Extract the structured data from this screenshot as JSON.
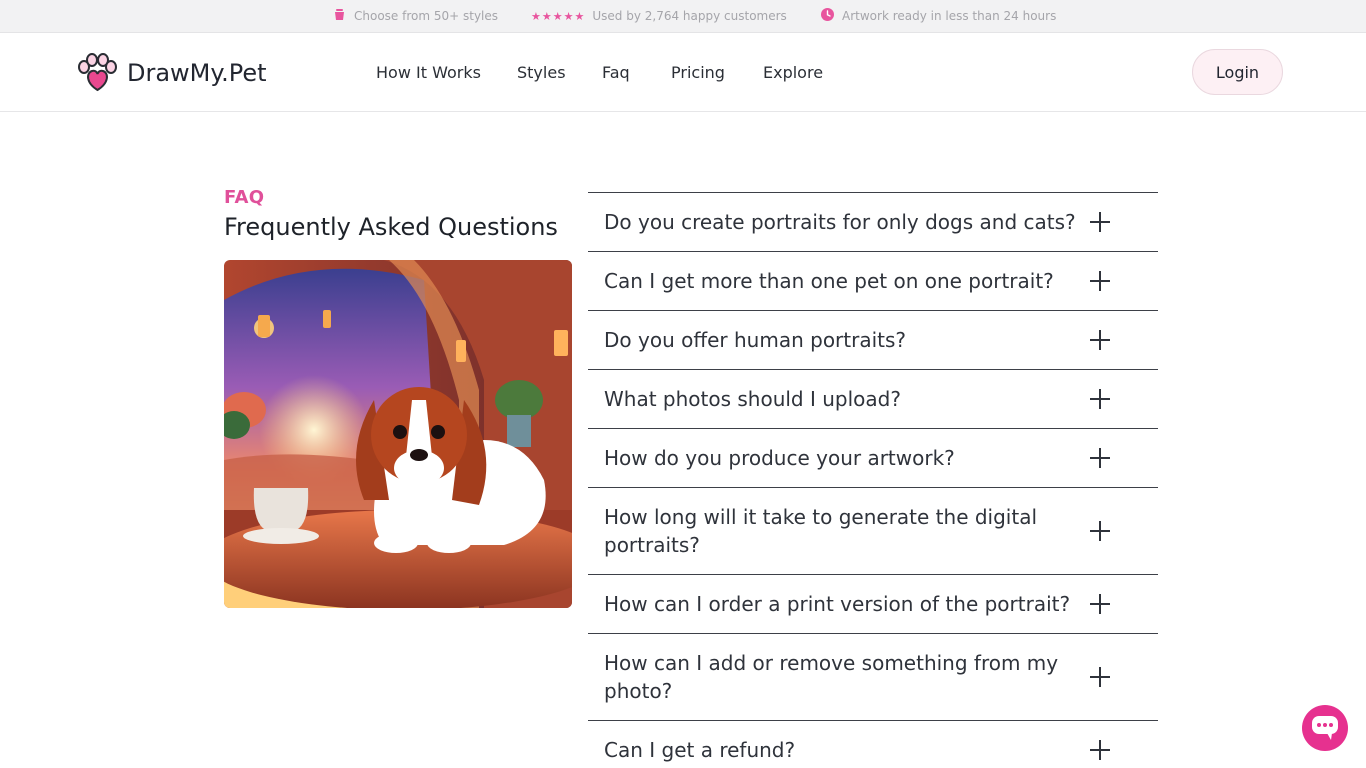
{
  "announcement": {
    "items": [
      {
        "icon": "bucket-icon",
        "text": "Choose from 50+ styles"
      },
      {
        "icon": "five-stars-icon",
        "text": "Used by 2,764 happy customers"
      },
      {
        "icon": "clock-icon",
        "text": "Artwork ready in less than 24 hours"
      }
    ]
  },
  "header": {
    "brand": "DrawMy.Pet",
    "nav": [
      "How It Works",
      "Styles",
      "Faq",
      "Pricing",
      "Explore"
    ],
    "login_label": "Login"
  },
  "faq": {
    "eyebrow": "FAQ",
    "title": "Frequently Asked Questions",
    "image_subject": "dog-in-cafe-painting",
    "questions": [
      "Do you create portraits for only dogs and cats?",
      "Can I get more than one pet on one portrait?",
      "Do you offer human portraits?",
      "What photos should I upload?",
      "How do you produce your artwork?",
      "How long will it take to generate the digital portraits?",
      "How can I order a print version of the portrait?",
      "How can I add or remove something from my photo?",
      "Can I get a refund?"
    ]
  },
  "chat": {
    "icon": "chat-bubble-icon"
  },
  "colors": {
    "accent": "#e0509a",
    "chat": "#e6318f",
    "login_bg": "#fdf0f4",
    "topbar_bg": "#f2f2f3"
  }
}
